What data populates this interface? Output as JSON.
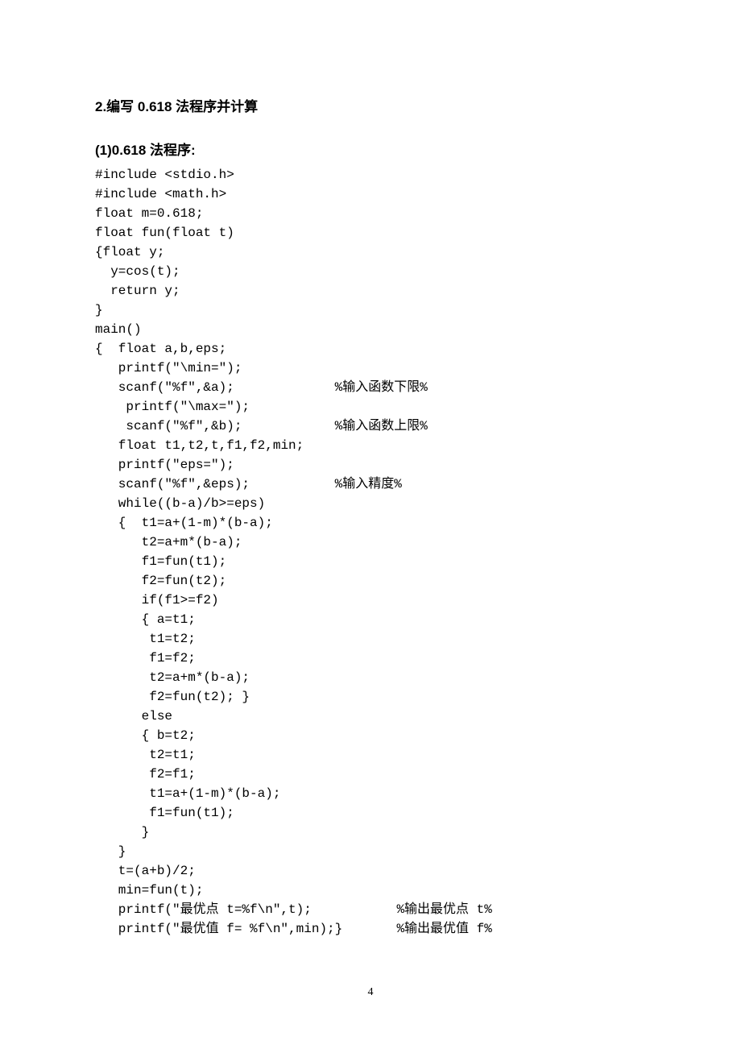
{
  "heading": "2.编写 0.618 法程序并计算",
  "subheading": "(1)0.618 法程序:",
  "code": "#include <stdio.h>\n#include <math.h>\nfloat m=0.618;\nfloat fun(float t)\n{float y;\n  y=cos(t);\n  return y;\n}\nmain()\n{  float a,b,eps;\n   printf(\"\\min=\");\n   scanf(\"%f\",&a);             %输入函数下限%\n    printf(\"\\max=\");\n    scanf(\"%f\",&b);            %输入函数上限%\n   float t1,t2,t,f1,f2,min;\n   printf(\"eps=\");\n   scanf(\"%f\",&eps);           %输入精度%\n   while((b-a)/b>=eps)\n   {  t1=a+(1-m)*(b-a);\n      t2=a+m*(b-a);\n      f1=fun(t1);\n      f2=fun(t2);\n      if(f1>=f2)\n      { a=t1;\n       t1=t2;\n       f1=f2;\n       t2=a+m*(b-a);\n       f2=fun(t2); }\n      else\n      { b=t2;\n       t2=t1;\n       f2=f1;\n       t1=a+(1-m)*(b-a);\n       f1=fun(t1);\n      }\n   }\n   t=(a+b)/2;\n   min=fun(t);\n   printf(\"最优点 t=%f\\n\",t);           %输出最优点 t%\n   printf(\"最优值 f= %f\\n\",min);}       %输出最优值 f%",
  "page_number": "4"
}
